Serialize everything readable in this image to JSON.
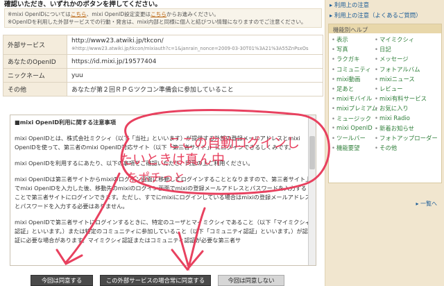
{
  "header": {
    "text": "確認いただき、いずれかのボタンを押してください。"
  },
  "notes": {
    "line1_prefix": "※mixi OpenIDについては",
    "line1_link1": "こちら",
    "line1_middle": "、mixi OpenID設定変更は",
    "line1_link2": "こちら",
    "line1_suffix": "からお進みください。",
    "line2": "※OpenIDを利用した外部サービスでの行動・発言は、mixi内部と同様に個人と結びつい情報になりますのでご注意ください。"
  },
  "info": {
    "service_label": "外部サービス",
    "service_url": "http://www23.atwiki.jp/tkcon/",
    "service_sub": "※http://www23.atwiki.jp/tkcon/mixiauth?c=1&janrain_nonce=2009-03-30T01%3A21%3A55ZnPsxOs",
    "openid_label": "あなたのOpenID",
    "openid_value": "https://id.mixi.jp/19577404",
    "nickname_label": "ニックネーム",
    "nickname_value": "yuu",
    "other_label": "その他",
    "other_value": "あなたが第２回ＲＰＧツクコン準備会に参加していること"
  },
  "terms": {
    "title": "■mixi OpenID利用に関する注意事項",
    "p1": "mixi OpenIDとは、株式会社ミクシィ（以下「当社」といいます）が提供する外部の登録メールアドレスとmixi OpenIDを使って、第三者のmixi OpenID対応サイト（以下「第三者サイト」）にログインできるしくみです。",
    "p2": "mixi OpenIDを利用するにあたり、以下の事項をご確認いただき、同意の上ご利用ください。",
    "p3": "mixi OpenIDは第三者サイトからmixiのログイン画面に移動してログインすることとなりますので、第三者サイト上でmixi OpenIDを入力した後、移動先のmixiのログイン画面でmixiの登録メールアドレスとパスワードを入力することで第三者サイトにログインできます。ただし、すでにmixiにログインしている場合はmixiの登録メールアドレスとパスワードを入力する必要はありません。",
    "p4": "mixi OpenIDで第三者サイトにログインするときに、特定のユーザとマイミクシィであること（以下「マイミクシィ認証」といいます。）または特定のコミュニティに参加していること（以下「コミュニティ認証」といいます。）が認証に必要な場合があります。マイミクシィ認証またはコミュニティ認証が必要な第三者サ"
  },
  "buttons": {
    "agree_once": "今回は同意する",
    "agree_always": "この外部サービスの場合常に同意する",
    "disagree": "今回は同意しない"
  },
  "sidebar": {
    "top_links": [
      "利用上の注意",
      "利用上の注意（よくあるご質問）"
    ],
    "help_title": "機能別ヘルプ",
    "help_left": [
      "表示",
      "写真",
      "ラクガキ",
      "コミュニティ",
      "mixi動画",
      "足あと",
      "mixiモバイル",
      "mixiプレミアム",
      "ミュージック",
      "mixi OpenID",
      "ツールバー",
      "機能要望"
    ],
    "help_right": [
      "マイミクシィ",
      "日記",
      "メッセージ",
      "フォトアルバム",
      "mixiニュース",
      "レビュー",
      "mixi有料サービス",
      "お気に入り",
      "mixi Radio",
      "新着お知らせ",
      "フォトアップローダー",
      "その他"
    ],
    "ichiran": "一覧へ"
  },
  "annotation": {
    "handwriting_line1": "ここの自動ログインし",
    "handwriting_line2": "たいときは真ん中",
    "handwriting_line3": "をポチっと",
    "color": "#e8415f"
  }
}
